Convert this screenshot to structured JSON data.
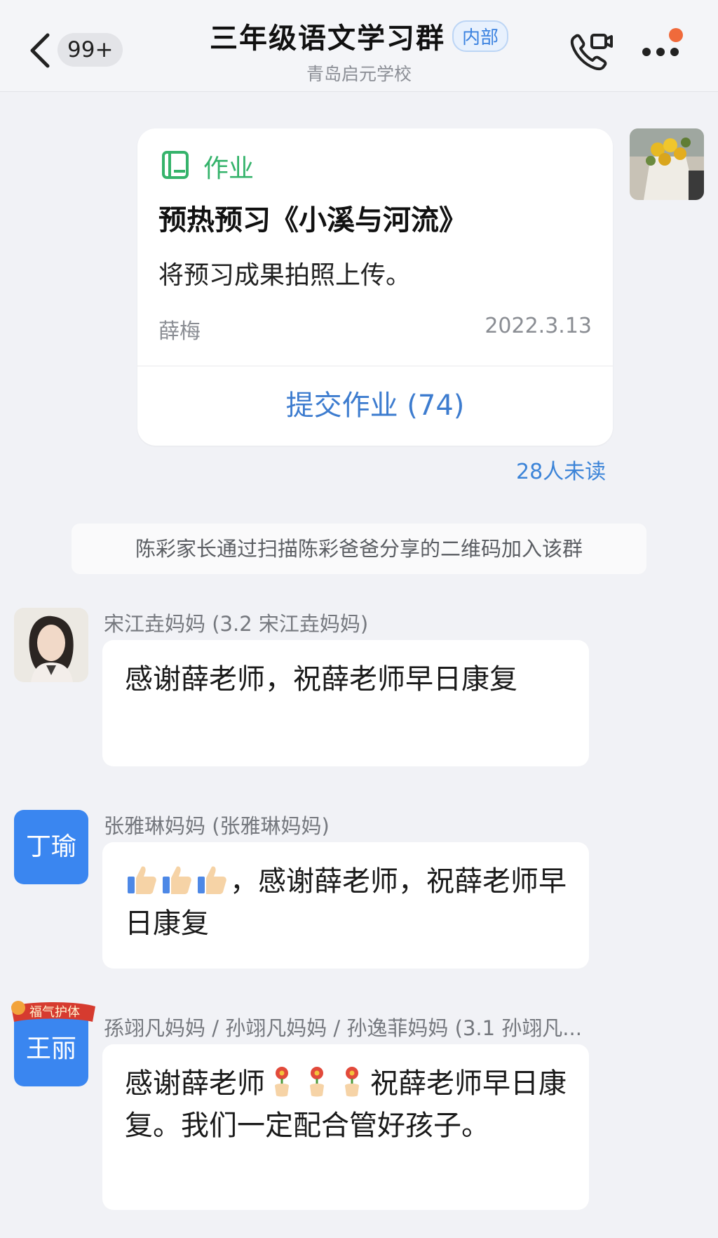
{
  "header": {
    "unread_badge": "99+",
    "title": "三年级语文学习群",
    "tag": "内部",
    "subtitle": "青岛启元学校"
  },
  "homework_card": {
    "type_label": "作业",
    "title": "预热预习《小溪与河流》",
    "description": "将预习成果拍照上传。",
    "author": "薛梅",
    "date": "2022.3.13",
    "submit_label": "提交作业 (74)",
    "unread_label": "28人未读"
  },
  "system_notice": "陈彩家长通过扫描陈彩爸爸分享的二维码加入该群",
  "messages": [
    {
      "sender": "宋江垚妈妈 (3.2 宋江垚妈妈)",
      "text": "感谢薛老师，祝薛老师早日康复"
    },
    {
      "sender": "张雅琳妈妈 (张雅琳妈妈)",
      "avatar_text": "丁瑜",
      "text": "，感谢薛老师，祝薛老师早日康复"
    },
    {
      "sender": "孫翊凡妈妈 / 孙翊凡妈妈 / 孙逸菲妈妈 (3.1 孙翊凡...",
      "avatar_text": "王丽",
      "avatar_badge": "福气护体",
      "text_before": "感谢薛老师",
      "text_after": "祝薛老师早日康复。我们一定配合管好孩子。"
    }
  ],
  "colors": {
    "accent_blue": "#3a86f0",
    "homework_green": "#35b36b",
    "badge_orange": "#f06a3b"
  },
  "icons": [
    "back-icon",
    "video-call-icon",
    "more-icon",
    "homework-book-icon",
    "thumbs-up-emoji",
    "flower-emoji"
  ]
}
